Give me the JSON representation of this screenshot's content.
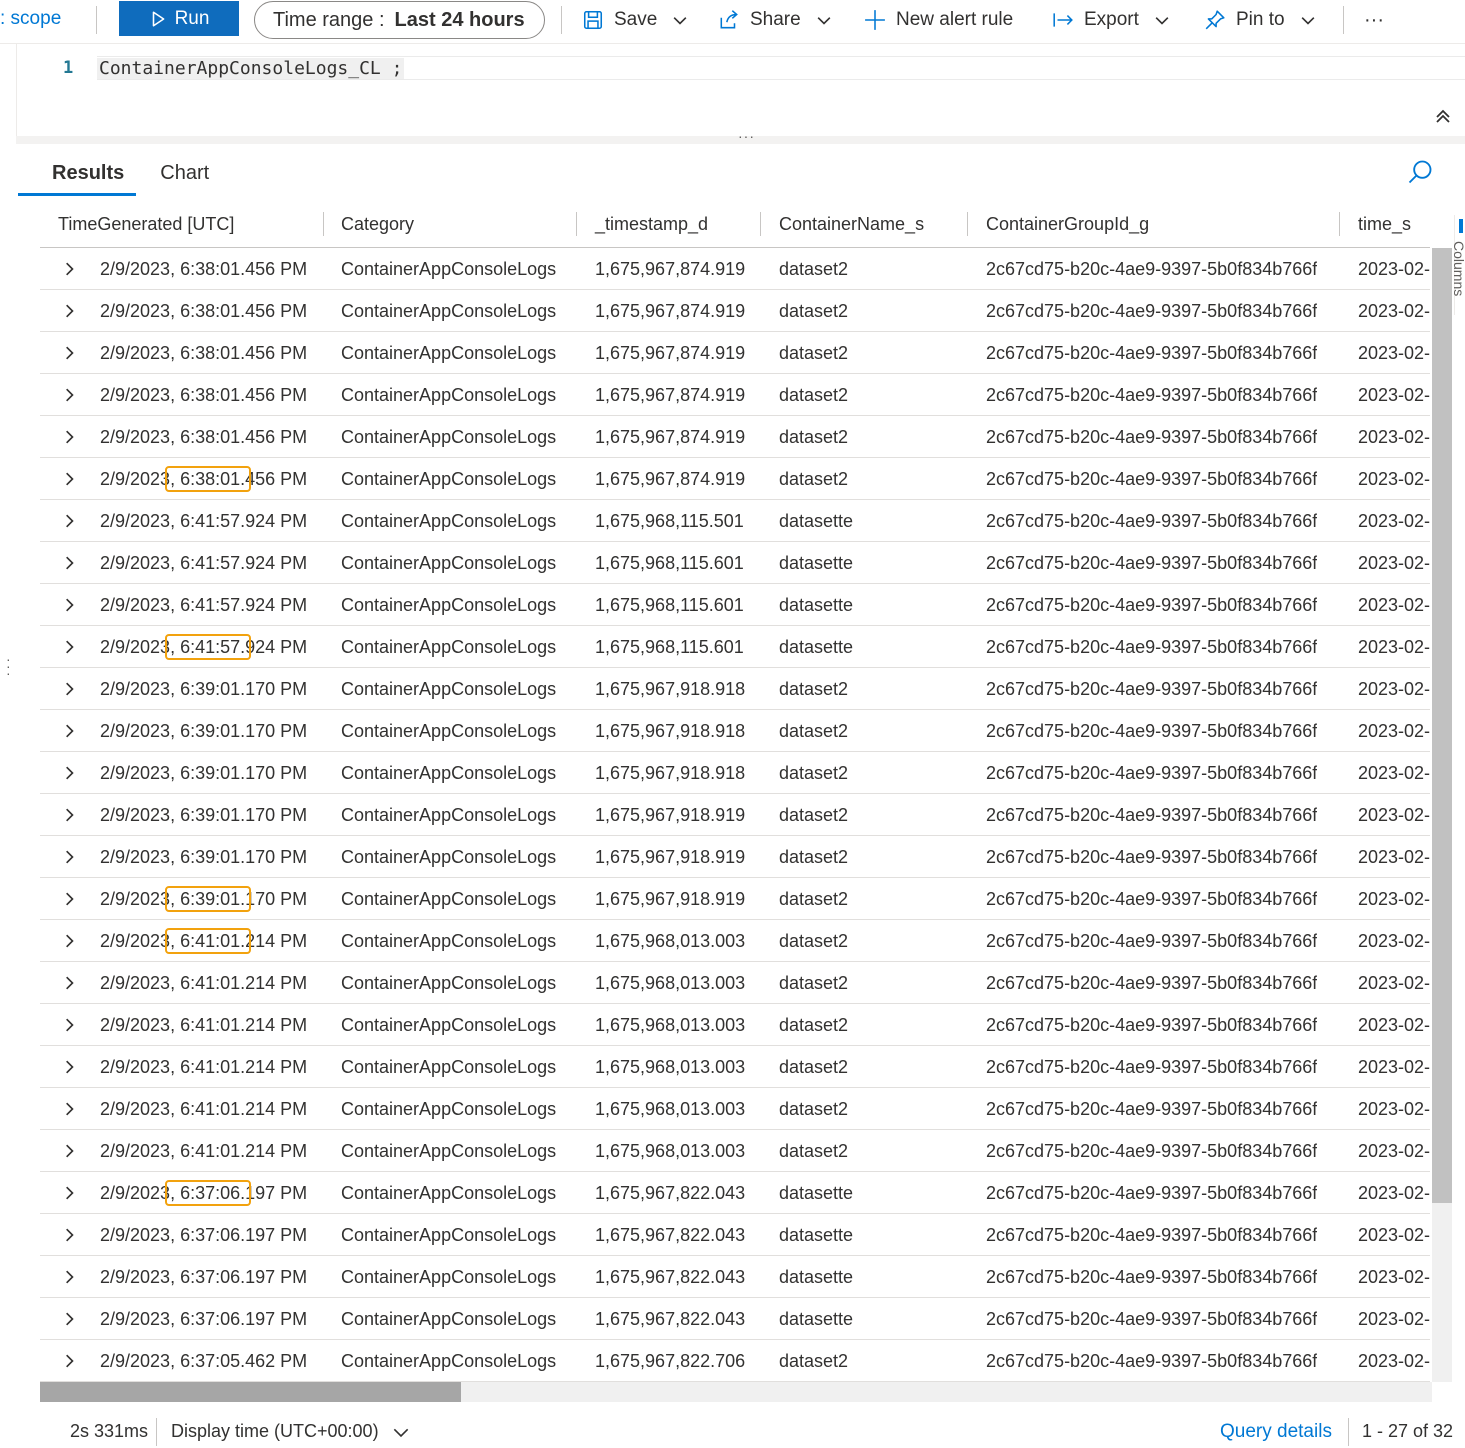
{
  "toolbar": {
    "scope_label": ": scope",
    "run_label": "Run",
    "time_range_label": "Time range :",
    "time_range_value": "Last 24 hours",
    "save_label": "Save",
    "share_label": "Share",
    "new_alert_label": "New alert rule",
    "export_label": "Export",
    "pin_label": "Pin to",
    "more_label": "···"
  },
  "editor": {
    "line_number": "1",
    "query": "ContainerAppConsoleLogs_CL ;"
  },
  "tabs": [
    {
      "label": "Results",
      "active": true
    },
    {
      "label": "Chart",
      "active": false
    }
  ],
  "columns": [
    "TimeGenerated [UTC]",
    "Category",
    "_timestamp_d",
    "ContainerName_s",
    "ContainerGroupId_g",
    "time_s"
  ],
  "rows": [
    {
      "time": "2/9/2023, 6:38:01.456 PM",
      "category": "ContainerAppConsoleLogs",
      "ts": "1,675,967,874.919",
      "container": "dataset2",
      "group": "2c67cd75-b20c-4ae9-9397-5b0f834b766f",
      "time_s": "2023-02-",
      "highlight": false
    },
    {
      "time": "2/9/2023, 6:38:01.456 PM",
      "category": "ContainerAppConsoleLogs",
      "ts": "1,675,967,874.919",
      "container": "dataset2",
      "group": "2c67cd75-b20c-4ae9-9397-5b0f834b766f",
      "time_s": "2023-02-",
      "highlight": false
    },
    {
      "time": "2/9/2023, 6:38:01.456 PM",
      "category": "ContainerAppConsoleLogs",
      "ts": "1,675,967,874.919",
      "container": "dataset2",
      "group": "2c67cd75-b20c-4ae9-9397-5b0f834b766f",
      "time_s": "2023-02-",
      "highlight": false
    },
    {
      "time": "2/9/2023, 6:38:01.456 PM",
      "category": "ContainerAppConsoleLogs",
      "ts": "1,675,967,874.919",
      "container": "dataset2",
      "group": "2c67cd75-b20c-4ae9-9397-5b0f834b766f",
      "time_s": "2023-02-",
      "highlight": false
    },
    {
      "time": "2/9/2023, 6:38:01.456 PM",
      "category": "ContainerAppConsoleLogs",
      "ts": "1,675,967,874.919",
      "container": "dataset2",
      "group": "2c67cd75-b20c-4ae9-9397-5b0f834b766f",
      "time_s": "2023-02-",
      "highlight": false
    },
    {
      "time": "2/9/2023, 6:38:01.456 PM",
      "category": "ContainerAppConsoleLogs",
      "ts": "1,675,967,874.919",
      "container": "dataset2",
      "group": "2c67cd75-b20c-4ae9-9397-5b0f834b766f",
      "time_s": "2023-02-",
      "highlight": true
    },
    {
      "time": "2/9/2023, 6:41:57.924 PM",
      "category": "ContainerAppConsoleLogs",
      "ts": "1,675,968,115.501",
      "container": "datasette",
      "group": "2c67cd75-b20c-4ae9-9397-5b0f834b766f",
      "time_s": "2023-02-",
      "highlight": false
    },
    {
      "time": "2/9/2023, 6:41:57.924 PM",
      "category": "ContainerAppConsoleLogs",
      "ts": "1,675,968,115.601",
      "container": "datasette",
      "group": "2c67cd75-b20c-4ae9-9397-5b0f834b766f",
      "time_s": "2023-02-",
      "highlight": false
    },
    {
      "time": "2/9/2023, 6:41:57.924 PM",
      "category": "ContainerAppConsoleLogs",
      "ts": "1,675,968,115.601",
      "container": "datasette",
      "group": "2c67cd75-b20c-4ae9-9397-5b0f834b766f",
      "time_s": "2023-02-",
      "highlight": false
    },
    {
      "time": "2/9/2023, 6:41:57.924 PM",
      "category": "ContainerAppConsoleLogs",
      "ts": "1,675,968,115.601",
      "container": "datasette",
      "group": "2c67cd75-b20c-4ae9-9397-5b0f834b766f",
      "time_s": "2023-02-",
      "highlight": true
    },
    {
      "time": "2/9/2023, 6:39:01.170 PM",
      "category": "ContainerAppConsoleLogs",
      "ts": "1,675,967,918.918",
      "container": "dataset2",
      "group": "2c67cd75-b20c-4ae9-9397-5b0f834b766f",
      "time_s": "2023-02-",
      "highlight": false
    },
    {
      "time": "2/9/2023, 6:39:01.170 PM",
      "category": "ContainerAppConsoleLogs",
      "ts": "1,675,967,918.918",
      "container": "dataset2",
      "group": "2c67cd75-b20c-4ae9-9397-5b0f834b766f",
      "time_s": "2023-02-",
      "highlight": false
    },
    {
      "time": "2/9/2023, 6:39:01.170 PM",
      "category": "ContainerAppConsoleLogs",
      "ts": "1,675,967,918.918",
      "container": "dataset2",
      "group": "2c67cd75-b20c-4ae9-9397-5b0f834b766f",
      "time_s": "2023-02-",
      "highlight": false
    },
    {
      "time": "2/9/2023, 6:39:01.170 PM",
      "category": "ContainerAppConsoleLogs",
      "ts": "1,675,967,918.919",
      "container": "dataset2",
      "group": "2c67cd75-b20c-4ae9-9397-5b0f834b766f",
      "time_s": "2023-02-",
      "highlight": false
    },
    {
      "time": "2/9/2023, 6:39:01.170 PM",
      "category": "ContainerAppConsoleLogs",
      "ts": "1,675,967,918.919",
      "container": "dataset2",
      "group": "2c67cd75-b20c-4ae9-9397-5b0f834b766f",
      "time_s": "2023-02-",
      "highlight": false
    },
    {
      "time": "2/9/2023, 6:39:01.170 PM",
      "category": "ContainerAppConsoleLogs",
      "ts": "1,675,967,918.919",
      "container": "dataset2",
      "group": "2c67cd75-b20c-4ae9-9397-5b0f834b766f",
      "time_s": "2023-02-",
      "highlight": true
    },
    {
      "time": "2/9/2023, 6:41:01.214 PM",
      "category": "ContainerAppConsoleLogs",
      "ts": "1,675,968,013.003",
      "container": "dataset2",
      "group": "2c67cd75-b20c-4ae9-9397-5b0f834b766f",
      "time_s": "2023-02-",
      "highlight": true
    },
    {
      "time": "2/9/2023, 6:41:01.214 PM",
      "category": "ContainerAppConsoleLogs",
      "ts": "1,675,968,013.003",
      "container": "dataset2",
      "group": "2c67cd75-b20c-4ae9-9397-5b0f834b766f",
      "time_s": "2023-02-",
      "highlight": false
    },
    {
      "time": "2/9/2023, 6:41:01.214 PM",
      "category": "ContainerAppConsoleLogs",
      "ts": "1,675,968,013.003",
      "container": "dataset2",
      "group": "2c67cd75-b20c-4ae9-9397-5b0f834b766f",
      "time_s": "2023-02-",
      "highlight": false
    },
    {
      "time": "2/9/2023, 6:41:01.214 PM",
      "category": "ContainerAppConsoleLogs",
      "ts": "1,675,968,013.003",
      "container": "dataset2",
      "group": "2c67cd75-b20c-4ae9-9397-5b0f834b766f",
      "time_s": "2023-02-",
      "highlight": false
    },
    {
      "time": "2/9/2023, 6:41:01.214 PM",
      "category": "ContainerAppConsoleLogs",
      "ts": "1,675,968,013.003",
      "container": "dataset2",
      "group": "2c67cd75-b20c-4ae9-9397-5b0f834b766f",
      "time_s": "2023-02-",
      "highlight": false
    },
    {
      "time": "2/9/2023, 6:41:01.214 PM",
      "category": "ContainerAppConsoleLogs",
      "ts": "1,675,968,013.003",
      "container": "dataset2",
      "group": "2c67cd75-b20c-4ae9-9397-5b0f834b766f",
      "time_s": "2023-02-",
      "highlight": false
    },
    {
      "time": "2/9/2023, 6:37:06.197 PM",
      "category": "ContainerAppConsoleLogs",
      "ts": "1,675,967,822.043",
      "container": "datasette",
      "group": "2c67cd75-b20c-4ae9-9397-5b0f834b766f",
      "time_s": "2023-02-",
      "highlight": true
    },
    {
      "time": "2/9/2023, 6:37:06.197 PM",
      "category": "ContainerAppConsoleLogs",
      "ts": "1,675,967,822.043",
      "container": "datasette",
      "group": "2c67cd75-b20c-4ae9-9397-5b0f834b766f",
      "time_s": "2023-02-",
      "highlight": false
    },
    {
      "time": "2/9/2023, 6:37:06.197 PM",
      "category": "ContainerAppConsoleLogs",
      "ts": "1,675,967,822.043",
      "container": "datasette",
      "group": "2c67cd75-b20c-4ae9-9397-5b0f834b766f",
      "time_s": "2023-02-",
      "highlight": false
    },
    {
      "time": "2/9/2023, 6:37:06.197 PM",
      "category": "ContainerAppConsoleLogs",
      "ts": "1,675,967,822.043",
      "container": "datasette",
      "group": "2c67cd75-b20c-4ae9-9397-5b0f834b766f",
      "time_s": "2023-02-",
      "highlight": false
    },
    {
      "time": "2/9/2023, 6:37:05.462 PM",
      "category": "ContainerAppConsoleLogs",
      "ts": "1,675,967,822.706",
      "container": "dataset2",
      "group": "2c67cd75-b20c-4ae9-9397-5b0f834b766f",
      "time_s": "2023-02-",
      "highlight": false
    }
  ],
  "side_panel": {
    "label": "Columns"
  },
  "footer": {
    "duration": "2s 331ms",
    "display_time": "Display time (UTC+00:00)",
    "query_details": "Query details",
    "count": "1 - 27 of 32"
  },
  "colors": {
    "accent": "#0078d4",
    "run_button": "#0f6cbd",
    "highlight_box": "#f2a20e"
  },
  "icons": [
    "play-icon",
    "save-icon",
    "share-icon",
    "plus-icon",
    "export-icon",
    "pin-icon",
    "chevron-down-icon",
    "collapse-up-icon",
    "search-icon",
    "chevron-right-icon"
  ]
}
